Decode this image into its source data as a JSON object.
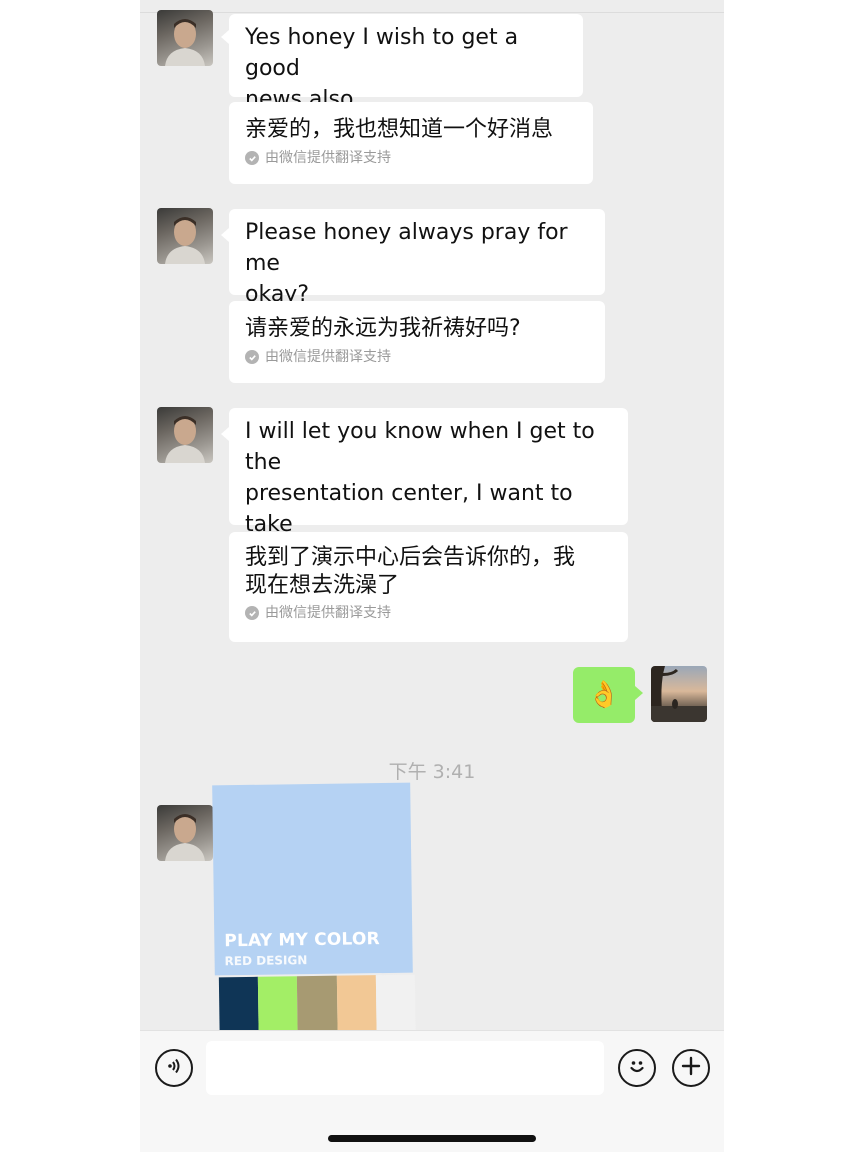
{
  "messages": [
    {
      "sender": "contact",
      "text": "Yes honey I wish to get a good\nnews also",
      "translation": "亲爱的，我也想知道一个好消息",
      "translation_note": "由微信提供翻译支持"
    },
    {
      "sender": "contact",
      "text": "Please honey always pray for me\nokay?",
      "translation": "请亲爱的永远为我祈祷好吗?",
      "translation_note": "由微信提供翻译支持"
    },
    {
      "sender": "contact",
      "text": "I will let you know when I get to the\npresentation center, I want to take\nmy shower now",
      "translation": "我到了演示中心后会告诉你的，我\n现在想去洗澡了",
      "translation_note": "由微信提供翻译支持"
    },
    {
      "sender": "me",
      "emoji": "👌"
    }
  ],
  "timestamp": "下午 3:41",
  "image_card": {
    "title": "PLAY MY COLOR",
    "subtitle": "RED DESIGN",
    "swatches": [
      "#0f3556",
      "#a3ee66",
      "#a79a72",
      "#f2c895",
      "#f1f1f1"
    ]
  },
  "input_bar": {
    "voice_icon": "voice-icon",
    "emoji_icon": "smiley-icon",
    "more_icon": "plus-icon",
    "input_value": ""
  },
  "colors": {
    "chat_background": "#ededed",
    "incoming_bubble": "#ffffff",
    "outgoing_bubble": "#95ec69",
    "translation_note": "#9a9a9a"
  }
}
